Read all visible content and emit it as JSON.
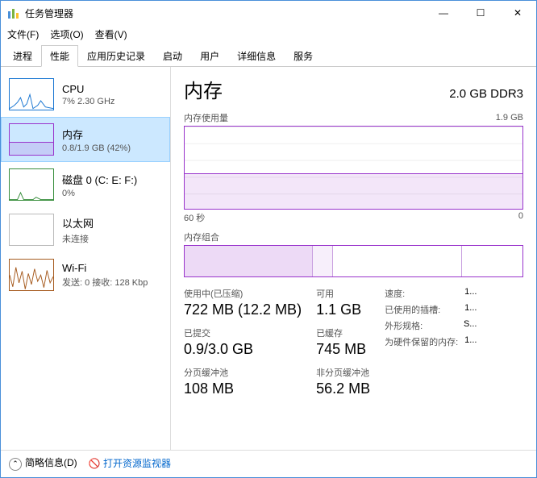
{
  "window": {
    "title": "任务管理器",
    "min": "—",
    "max": "☐",
    "close": "✕"
  },
  "menu": {
    "file": "文件(F)",
    "options": "选项(O)",
    "view": "查看(V)"
  },
  "tabs": [
    "进程",
    "性能",
    "应用历史记录",
    "启动",
    "用户",
    "详细信息",
    "服务"
  ],
  "sidebar": {
    "items": [
      {
        "name": "CPU",
        "detail": "7% 2.30 GHz"
      },
      {
        "name": "内存",
        "detail": "0.8/1.9 GB (42%)"
      },
      {
        "name": "磁盘 0 (C: E: F:)",
        "detail": "0%"
      },
      {
        "name": "以太网",
        "detail": "未连接"
      },
      {
        "name": "Wi-Fi",
        "detail": "发送: 0 接收: 128 Kbp"
      }
    ]
  },
  "main": {
    "title": "内存",
    "spec": "2.0 GB DDR3",
    "usage_label": "内存使用量",
    "usage_max": "1.9 GB",
    "axis_left": "60 秒",
    "axis_right": "0",
    "composition_label": "内存组合",
    "stats": {
      "in_use_lbl": "使用中(已压缩)",
      "in_use_val": "722 MB (12.2 MB)",
      "avail_lbl": "可用",
      "avail_val": "1.1 GB",
      "committed_lbl": "已提交",
      "committed_val": "0.9/3.0 GB",
      "cached_lbl": "已缓存",
      "cached_val": "745 MB",
      "paged_lbl": "分页缓冲池",
      "paged_val": "108 MB",
      "nonpaged_lbl": "非分页缓冲池",
      "nonpaged_val": "56.2 MB"
    },
    "spec_rows": [
      {
        "k": "速度:",
        "v": "1..."
      },
      {
        "k": "已使用的插槽:",
        "v": "1..."
      },
      {
        "k": "外形规格:",
        "v": "S..."
      },
      {
        "k": "为硬件保留的内存:",
        "v": "1..."
      }
    ]
  },
  "footer": {
    "brief": "简略信息(D)",
    "resmon": "打开资源监视器"
  },
  "chart_data": {
    "type": "area",
    "title": "内存使用量",
    "ylabel": "GB",
    "ylim": [
      0,
      1.9
    ],
    "xlabel": "秒",
    "xlim": [
      60,
      0
    ],
    "series": [
      {
        "name": "内存",
        "values": [
          0.8,
          0.8,
          0.8,
          0.8,
          0.8,
          0.8,
          0.8,
          0.8,
          0.8,
          0.8,
          0.8,
          0.8
        ]
      }
    ]
  }
}
